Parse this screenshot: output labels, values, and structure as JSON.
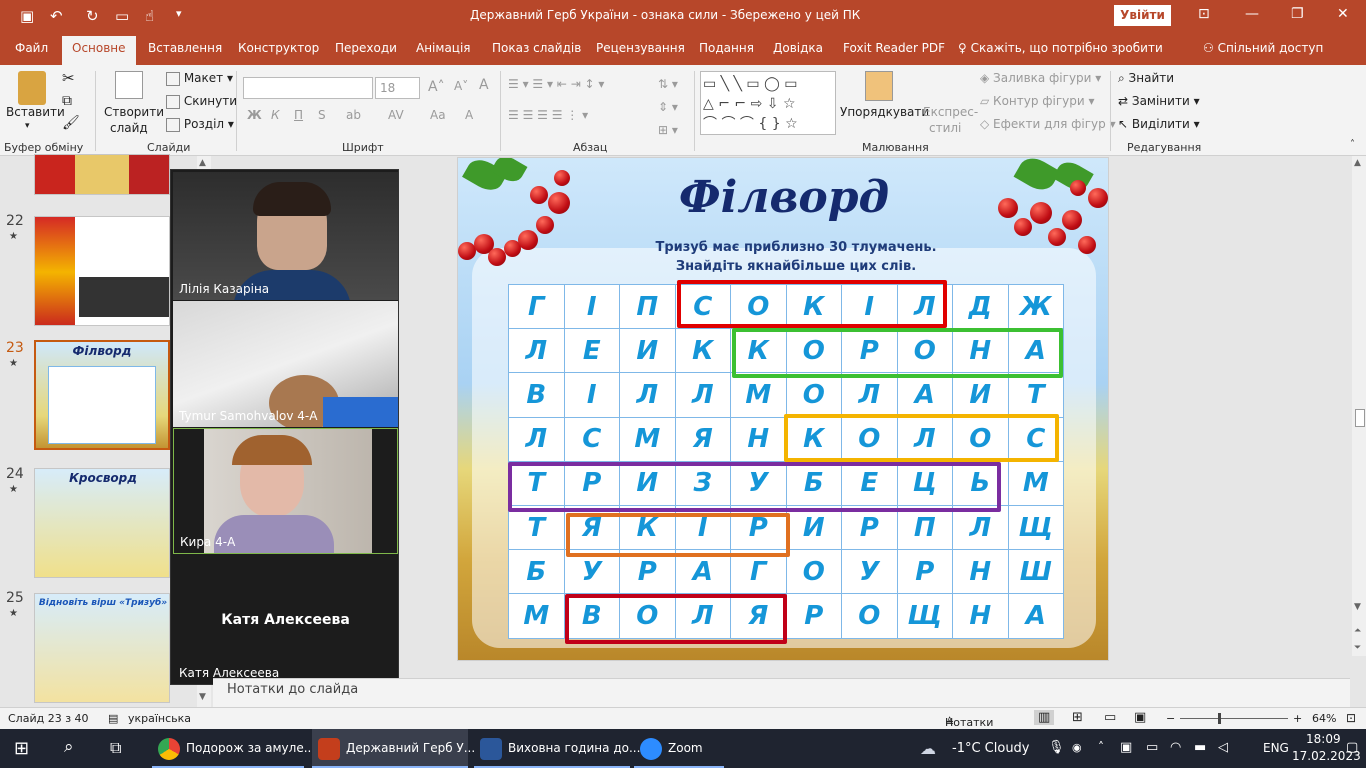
{
  "titlebar": {
    "title": "Державний Герб України - ознака сили  -  Збережено у цей ПК",
    "signin": "Увійти"
  },
  "tabs": [
    "Файл",
    "Основне",
    "Вставлення",
    "Конструктор",
    "Переходи",
    "Анімація",
    "Показ слайдів",
    "Рецензування",
    "Подання",
    "Довідка",
    "Foxit Reader PDF"
  ],
  "tellme": "Скажіть, що потрібно зробити",
  "share": "Спільний доступ",
  "ribbon": {
    "clipboard": {
      "paste": "Вставити",
      "label": "Буфер обміну"
    },
    "slides": {
      "new_slide": "Створити",
      "new_slide2": "слайд",
      "layout": "Макет",
      "reset": "Скинути",
      "section": "Розділ",
      "label": "Слайди"
    },
    "font": {
      "size": "18",
      "bold": "Ж",
      "italic": "К",
      "underline": "П",
      "strike": "S",
      "label": "Шрифт"
    },
    "paragraph": {
      "label": "Абзац"
    },
    "drawing": {
      "arrange": "Упорядкувати",
      "quick_styles": "Експрес-",
      "quick_styles2": "стилі",
      "fill": "Заливка фігури",
      "outline": "Контур фігури",
      "effects": "Ефекти для фігур",
      "label": "Малювання"
    },
    "editing": {
      "find": "Знайти",
      "replace": "Замінити",
      "select": "Виділити",
      "label": "Редагування"
    }
  },
  "thumbnails": [
    {
      "num": "22",
      "star": "★"
    },
    {
      "num": "23",
      "star": "★",
      "title": "Філворд"
    },
    {
      "num": "24",
      "star": "★",
      "title": "Кросворд"
    },
    {
      "num": "25",
      "star": "★",
      "title": "Відновіть вірш «Тризуб»"
    }
  ],
  "zoom": {
    "participants": [
      "Лілія Казаріна",
      "Tymur Samohvalov 4-А",
      "Кира 4-А",
      "Катя Алексеева"
    ],
    "center_name": "Катя Алексеева"
  },
  "slide": {
    "title": "Філворд",
    "subtitle1": "Тризуб має приблизно 30 тлумачень.",
    "subtitle2": "Знайдіть якнайбільше цих слів.",
    "grid": [
      [
        "Г",
        "І",
        "П",
        "С",
        "О",
        "К",
        "І",
        "Л",
        "Д",
        "Ж"
      ],
      [
        "Л",
        "Е",
        "И",
        "К",
        "К",
        "О",
        "Р",
        "О",
        "Н",
        "А"
      ],
      [
        "В",
        "І",
        "Л",
        "Л",
        "М",
        "О",
        "Л",
        "А",
        "И",
        "Т"
      ],
      [
        "Л",
        "С",
        "М",
        "Я",
        "Н",
        "К",
        "О",
        "Л",
        "О",
        "С"
      ],
      [
        "Т",
        "Р",
        "И",
        "З",
        "У",
        "Б",
        "Е",
        "Ц",
        "Ь",
        "М"
      ],
      [
        "Т",
        "Я",
        "К",
        "І",
        "Р",
        "И",
        "Р",
        "П",
        "Л",
        "Щ"
      ],
      [
        "Б",
        "У",
        "Р",
        "А",
        "Г",
        "О",
        "У",
        "Р",
        "Н",
        "Ш"
      ],
      [
        "М",
        "В",
        "О",
        "Л",
        "Я",
        "Р",
        "О",
        "Щ",
        "Н",
        "А"
      ]
    ],
    "highlight_colors": [
      "#e00000",
      "#3cc032",
      "#f4b400",
      "#7a2da0",
      "#e07020",
      "#c00018"
    ]
  },
  "notes": "Нотатки до слайда",
  "status": {
    "slide": "Слайд 23 з 40",
    "lang": "українська",
    "notes": "Нотатки",
    "zoom": "64%"
  },
  "taskbar": {
    "items": [
      "Подорож за амуле...",
      "Державний Герб У...",
      "Виховна година до...",
      "Zoom"
    ],
    "weather": "-1°C  Cloudy",
    "lang": "ENG",
    "time": "18:09",
    "date": "17.02.2023"
  }
}
